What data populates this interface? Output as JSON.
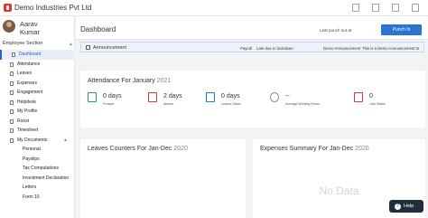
{
  "header": {
    "company": "Demo Industries Pvt Ltd"
  },
  "profile": {
    "first_name": "Aarav",
    "last_name": "Kumar"
  },
  "sidebar": {
    "section": "Employee Section",
    "items": [
      {
        "label": "Dashboard",
        "active": true
      },
      {
        "label": "Attendance"
      },
      {
        "label": "Leaves"
      },
      {
        "label": "Expenses"
      },
      {
        "label": "Engagement"
      },
      {
        "label": "Helpdesk"
      },
      {
        "label": "My Profile"
      },
      {
        "label": "Roost"
      },
      {
        "label": "Timesheet"
      },
      {
        "label": "My Documents"
      }
    ],
    "sub_items": [
      {
        "label": "Personal"
      },
      {
        "label": "Payslips"
      },
      {
        "label": "Tax Computations"
      },
      {
        "label": "Investment Declaration"
      },
      {
        "label": "Letters"
      },
      {
        "label": "Form 16"
      }
    ]
  },
  "page": {
    "title": "Dashboard",
    "punch_status": "Last punch out at",
    "punch_button": "Punch In"
  },
  "announcement": {
    "label": "Announcement",
    "items": [
      "Payroll",
      "Late due to lockdown",
      "Demo Announcement",
      "This is a Demo Announcement to"
    ]
  },
  "attendance": {
    "title": "Attendance For January",
    "year": "2021",
    "stats": [
      {
        "value": "0 days",
        "label": "Present",
        "icon": "calendar-check-icon",
        "color": "#2e9e5b"
      },
      {
        "value": "2 days",
        "label": "Absent",
        "icon": "calendar-x-icon",
        "color": "#e0362f"
      },
      {
        "value": "0 days",
        "label": "Leaves Taken",
        "icon": "calendar-leave-icon",
        "color": "#2a74d3"
      },
      {
        "value": "--",
        "label": "Average Working Hours",
        "icon": "clock-icon",
        "color": "#8b8f95"
      },
      {
        "value": "0",
        "label": "Late Marks",
        "icon": "calendar-late-icon",
        "color": "#e0362f"
      }
    ]
  },
  "leaves_card": {
    "title": "Leaves Counters For Jan-Dec",
    "year": "2020"
  },
  "expenses_card": {
    "title": "Expenses Summary For Jan-Dec",
    "year": "2020",
    "empty": "No Data"
  },
  "help": {
    "label": "Help"
  }
}
